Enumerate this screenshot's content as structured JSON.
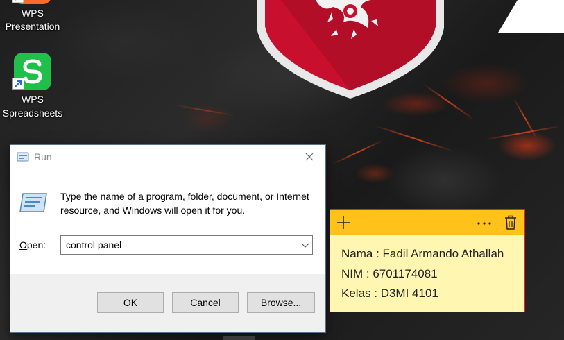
{
  "desktop": {
    "icons": [
      {
        "label_line1": "WPS",
        "label_line2": "Presentation",
        "icon": "wps-presentation-icon"
      },
      {
        "label_line1": "WPS",
        "label_line2": "Spreadsheets",
        "icon": "wps-spreadsheets-icon"
      }
    ],
    "wallpaper_colors": {
      "shield_red": "#c8102e",
      "lava": "#ff4a1a"
    }
  },
  "run_dialog": {
    "title": "Run",
    "description": "Type the name of a program, folder, document, or Internet resource, and Windows will open it for you.",
    "open_label_underlined": "O",
    "open_label_rest": "pen:",
    "open_value": "control panel",
    "buttons": {
      "ok": "OK",
      "cancel": "Cancel",
      "browse_underlined": "B",
      "browse_rest": "rowse..."
    }
  },
  "sticky_note": {
    "header_color": "#ffc21a",
    "body_color": "#fff7b1",
    "lines": [
      "Nama : Fadil Armando Athallah",
      "NIM : 6701174081",
      "Kelas : D3MI 4101"
    ]
  }
}
